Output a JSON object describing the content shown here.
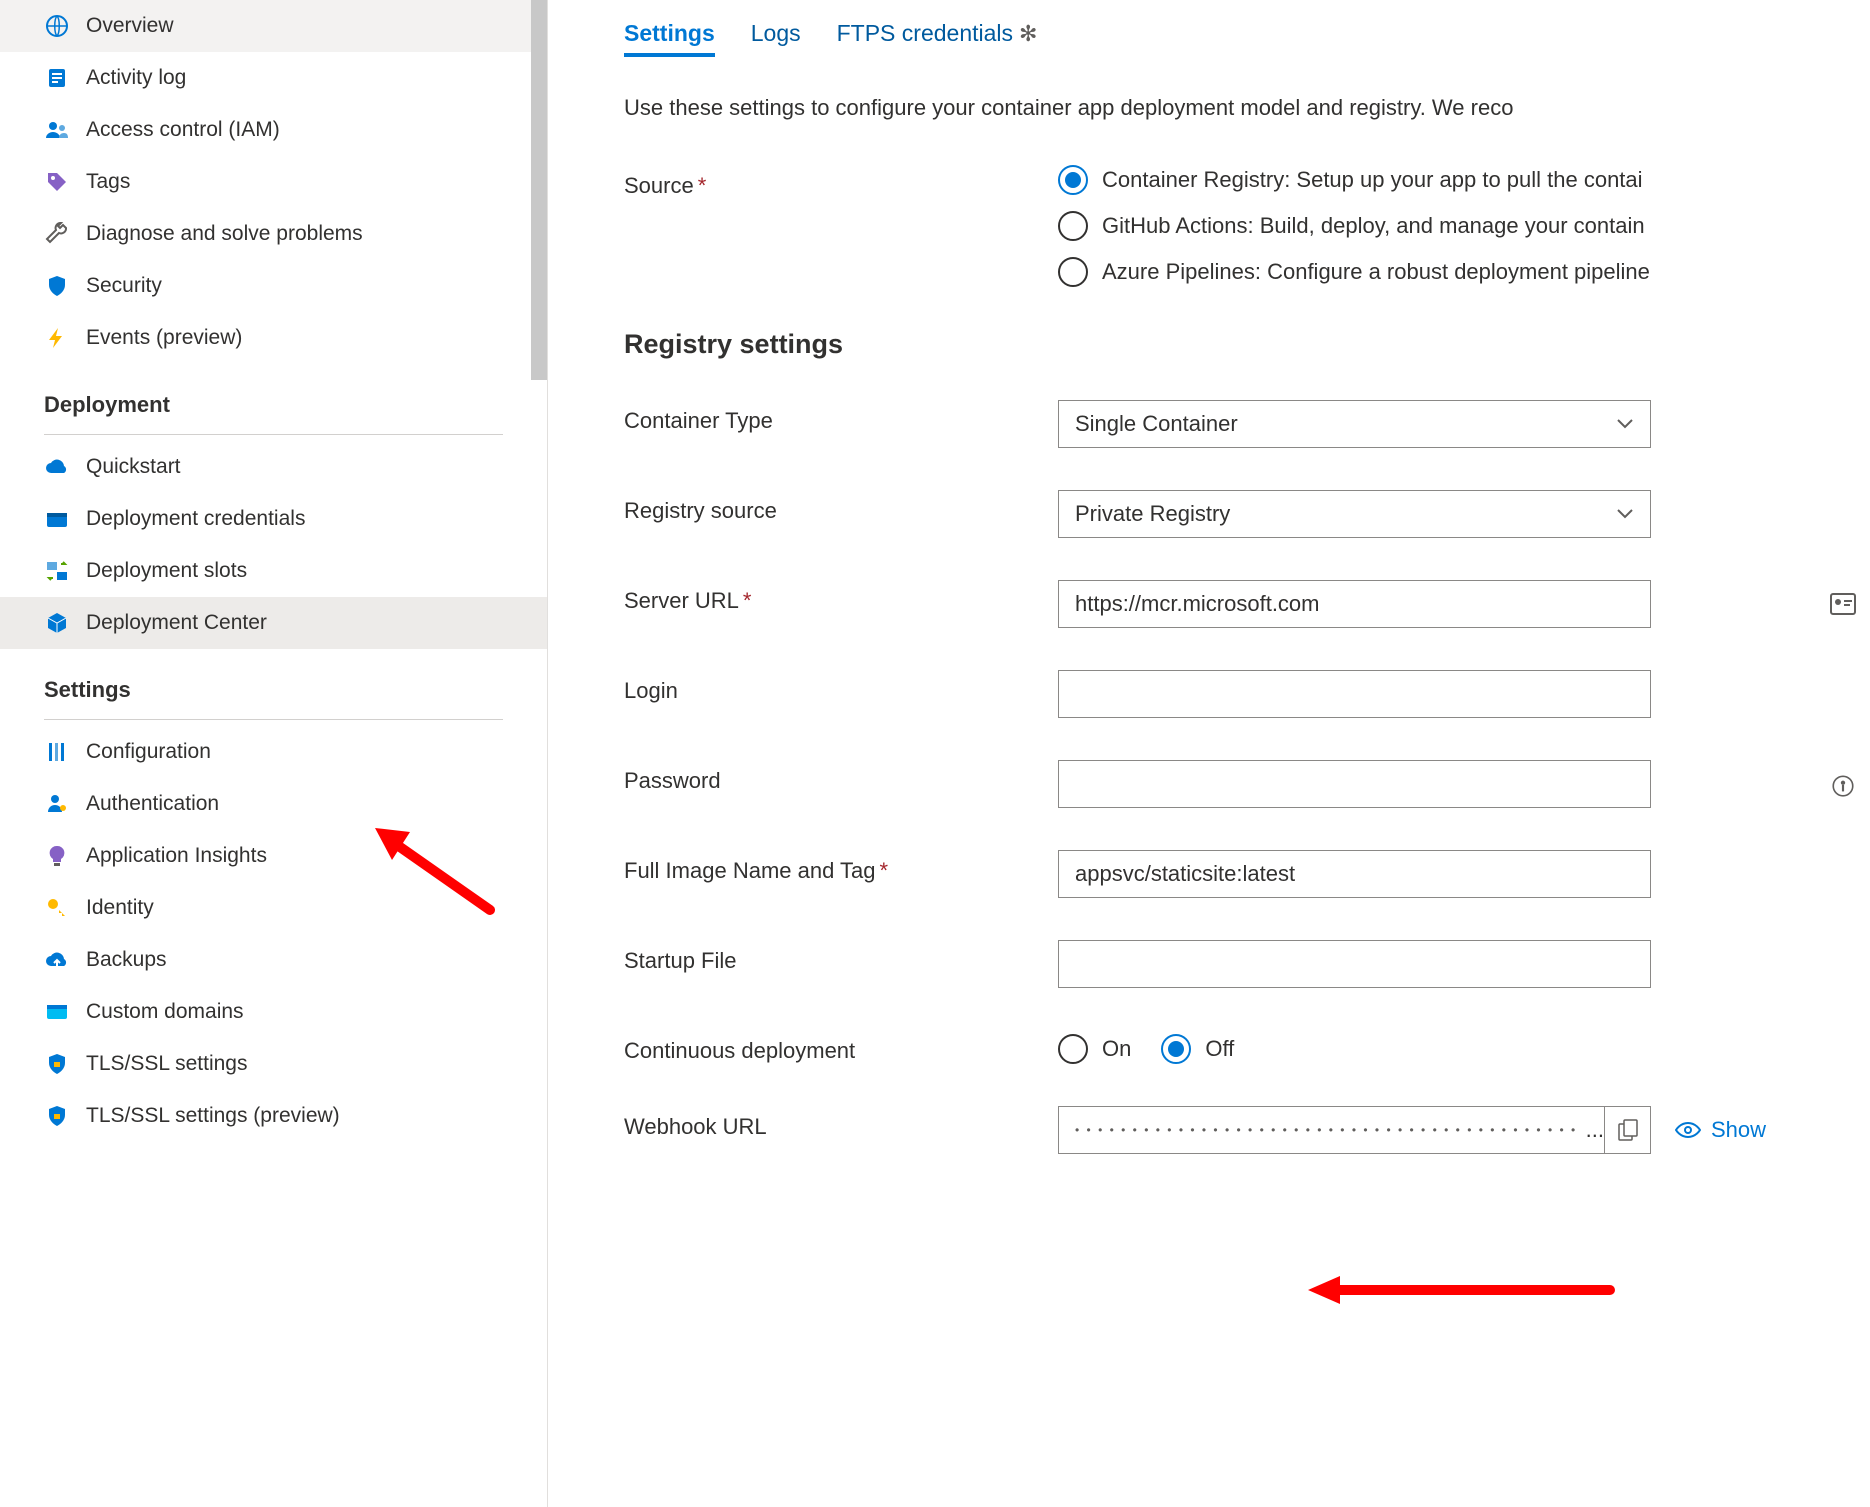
{
  "sidebar": {
    "topItems": [
      {
        "label": "Overview",
        "icon": "globe"
      },
      {
        "label": "Activity log",
        "icon": "log"
      },
      {
        "label": "Access control (IAM)",
        "icon": "people"
      },
      {
        "label": "Tags",
        "icon": "tag"
      },
      {
        "label": "Diagnose and solve problems",
        "icon": "wrench"
      },
      {
        "label": "Security",
        "icon": "shield-blue"
      },
      {
        "label": "Events (preview)",
        "icon": "bolt"
      }
    ],
    "sections": [
      {
        "title": "Deployment",
        "items": [
          {
            "label": "Quickstart",
            "icon": "cloud"
          },
          {
            "label": "Deployment credentials",
            "icon": "creds"
          },
          {
            "label": "Deployment slots",
            "icon": "slots"
          },
          {
            "label": "Deployment Center",
            "icon": "box",
            "active": true
          }
        ]
      },
      {
        "title": "Settings",
        "items": [
          {
            "label": "Configuration",
            "icon": "sliders"
          },
          {
            "label": "Authentication",
            "icon": "person-key"
          },
          {
            "label": "Application Insights",
            "icon": "lightbulb"
          },
          {
            "label": "Identity",
            "icon": "key"
          },
          {
            "label": "Backups",
            "icon": "cloud-up"
          },
          {
            "label": "Custom domains",
            "icon": "browser"
          },
          {
            "label": "TLS/SSL settings",
            "icon": "shield-lock"
          },
          {
            "label": "TLS/SSL settings (preview)",
            "icon": "shield-lock"
          }
        ]
      }
    ]
  },
  "tabs": {
    "settings": "Settings",
    "logs": "Logs",
    "ftps": "FTPS credentials"
  },
  "intro": "Use these settings to configure your container app deployment model and registry. We reco",
  "sourceField": {
    "label": "Source",
    "options": [
      {
        "label": "Container Registry: Setup up your app to pull the contai",
        "selected": true
      },
      {
        "label": "GitHub Actions: Build, deploy, and manage your contain",
        "selected": false
      },
      {
        "label": "Azure Pipelines: Configure a robust deployment pipeline",
        "selected": false
      }
    ]
  },
  "registrySection": {
    "heading": "Registry settings",
    "containerType": {
      "label": "Container Type",
      "value": "Single Container"
    },
    "registrySource": {
      "label": "Registry source",
      "value": "Private Registry"
    },
    "serverUrl": {
      "label": "Server URL",
      "value": "https://mcr.microsoft.com"
    },
    "login": {
      "label": "Login",
      "value": ""
    },
    "password": {
      "label": "Password",
      "value": ""
    },
    "imageNameTag": {
      "label": "Full Image Name and Tag",
      "value": "appsvc/staticsite:latest"
    },
    "startupFile": {
      "label": "Startup File",
      "value": ""
    },
    "continuousDeployment": {
      "label": "Continuous deployment",
      "on": "On",
      "off": "Off",
      "selected": "off"
    },
    "webhook": {
      "label": "Webhook URL",
      "maskedSuffix": "...",
      "showLabel": "Show"
    }
  }
}
